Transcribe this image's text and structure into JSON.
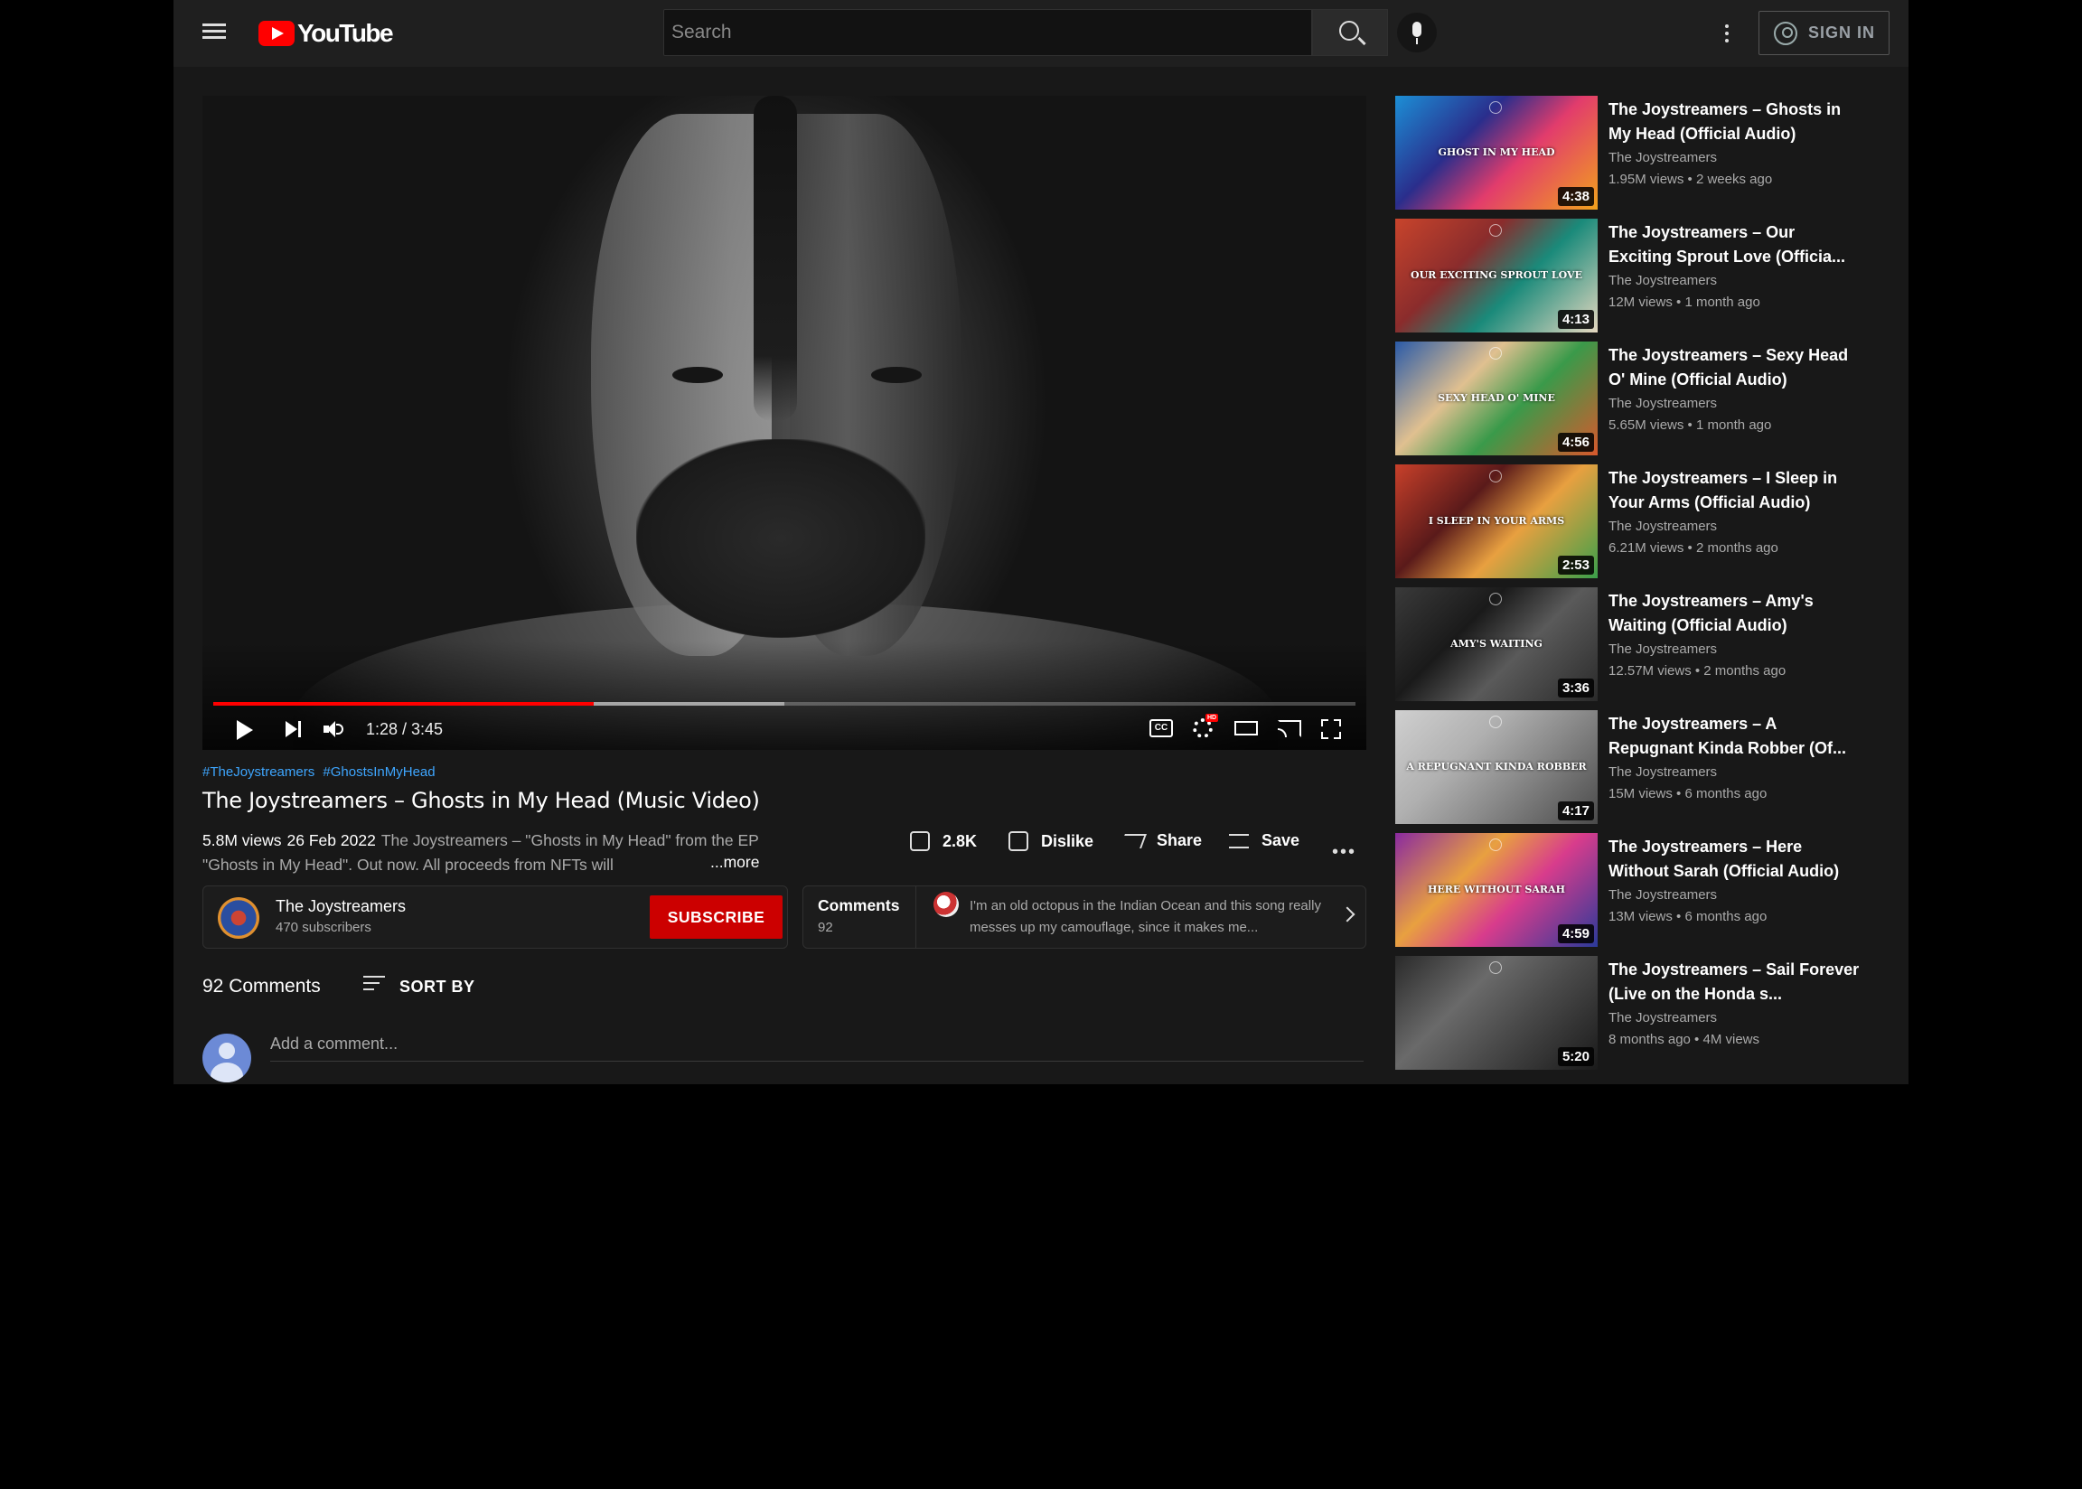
{
  "header": {
    "logo_text": "YouTube",
    "search_placeholder": "Search",
    "signin_label": "SIGN IN"
  },
  "player": {
    "timecode": "1:28 / 3:45",
    "progress": 0.333,
    "buffered": 0.5,
    "cc_label": "CC",
    "hd_badge": "HD"
  },
  "video": {
    "hashtags": [
      "#TheJoystreamers",
      "#GhostsInMyHead"
    ],
    "title": "The Joystreamers – Ghosts in My Head (Music Video)",
    "views": "5.8M views",
    "date": "26 Feb 2022",
    "description": "The Joystreamers – \"Ghosts in My Head\" from the EP \"Ghosts in My Head\". Out now. All proceeds from NFTs will",
    "more_label": "...more",
    "likes": "2.8K",
    "dislike_label": "Dislike",
    "share_label": "Share",
    "save_label": "Save"
  },
  "channel": {
    "name": "The Joystreamers",
    "subscribers": "470 subscribers",
    "subscribe_label": "SUBSCRIBE"
  },
  "comments_teaser": {
    "label": "Comments",
    "count": "92",
    "preview": "I'm an old octopus in the Indian Ocean and this song really messes up my camouflage, since it makes me..."
  },
  "comments": {
    "header": "92 Comments",
    "sort_label": "SORT BY",
    "add_placeholder": "Add a comment..."
  },
  "recommendations": [
    {
      "title": "The Joystreamers – Ghosts in My Head (Official Audio)",
      "channel": "The Joystreamers",
      "meta": "1.95M views • 2 weeks ago",
      "duration": "4:38",
      "art_title": "GHOST IN MY HEAD",
      "colors": [
        "#1c8fd6",
        "#e23c6c",
        "#f2a21c",
        "#2a2e8c"
      ]
    },
    {
      "title": "The Joystreamers – Our Exciting Sprout Love (Officia...",
      "channel": "The Joystreamers",
      "meta": "12M views • 1 month ago",
      "duration": "4:13",
      "art_title": "OUR EXCITING SPROUT LOVE",
      "colors": [
        "#c8442c",
        "#1a8a7a",
        "#e6d8c0",
        "#8a2c2c"
      ]
    },
    {
      "title": "The Joystreamers – Sexy Head O' Mine (Official Audio)",
      "channel": "The Joystreamers",
      "meta": "5.65M views • 1 month ago",
      "duration": "4:56",
      "art_title": "SEXY HEAD O' MINE",
      "colors": [
        "#2a5aa8",
        "#3a9a4a",
        "#d8582c",
        "#e0c090"
      ]
    },
    {
      "title": "The Joystreamers – I Sleep in Your Arms (Official Audio)",
      "channel": "The Joystreamers",
      "meta": "6.21M views • 2 months ago",
      "duration": "2:53",
      "art_title": "I SLEEP IN YOUR ARMS",
      "colors": [
        "#c8402a",
        "#e8a040",
        "#3aa04a",
        "#5a1a1a"
      ]
    },
    {
      "title": "The Joystreamers – Amy's Waiting (Official Audio)",
      "channel": "The Joystreamers",
      "meta": "12.57M views • 2 months ago",
      "duration": "3:36",
      "art_title": "AMY'S WAITING",
      "colors": [
        "#3a3a3a",
        "#5a5a5a",
        "#2a2a2a",
        "#1a1a1a"
      ]
    },
    {
      "title": "The Joystreamers – A Repugnant Kinda Robber (Of...",
      "channel": "The Joystreamers",
      "meta": "15M views • 6 months ago",
      "duration": "4:17",
      "art_title": "A REPUGNANT KINDA ROBBER",
      "colors": [
        "#d0d0d0",
        "#8a8a8a",
        "#4a4a4a",
        "#b0b0b0"
      ]
    },
    {
      "title": "The Joystreamers – Here Without Sarah (Official Audio)",
      "channel": "The Joystreamers",
      "meta": "13M views • 6 months ago",
      "duration": "4:59",
      "art_title": "HERE WITHOUT SARAH",
      "colors": [
        "#8a2aa0",
        "#d83c8c",
        "#2a3a9a",
        "#e8a040"
      ]
    },
    {
      "title": "The Joystreamers – Sail Forever (Live on the Honda s...",
      "channel": "The Joystreamers",
      "meta": "8 months ago • 4M views",
      "duration": "5:20",
      "art_title": "",
      "colors": [
        "#2a2a2a",
        "#4a4a4a",
        "#1a1a1a",
        "#6a6a6a"
      ]
    }
  ]
}
